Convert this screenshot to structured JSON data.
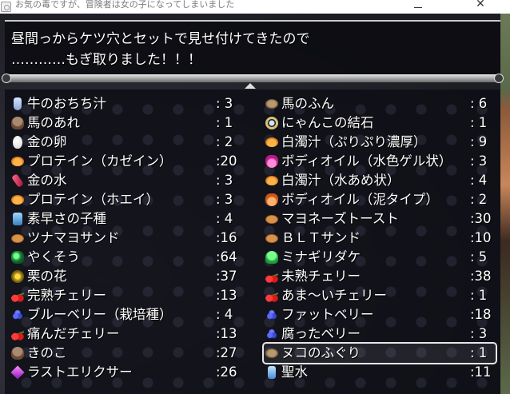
{
  "window": {
    "title": "お気の毒ですが、冒険者は女の子になってしまいました",
    "minimize_glyph": "—",
    "close_glyph": "✕"
  },
  "message": {
    "line1": "昼間っからケツ穴とセットで見せ付けてきたので",
    "line2": "…………もぎ取りました！！！"
  },
  "items_left": [
    {
      "icon": "bottle-icon",
      "name": "牛のおちち汁",
      "qty": ": 3"
    },
    {
      "icon": "mushroom-icon",
      "name": "馬のあれ",
      "qty": ": 1"
    },
    {
      "icon": "egg-icon",
      "name": "金の卵",
      "qty": ": 2"
    },
    {
      "icon": "shell-icon",
      "name": "プロテイン（カゼイン）",
      "qty": ":20"
    },
    {
      "icon": "red-vial-icon",
      "name": "金の水",
      "qty": ": 3"
    },
    {
      "icon": "shell-icon",
      "name": "プロテイン（ホエイ）",
      "qty": ": 3"
    },
    {
      "icon": "jar-icon",
      "name": "素早さの子種",
      "qty": ": 4"
    },
    {
      "icon": "bread-icon",
      "name": "ツナマヨサンド",
      "qty": ":16"
    },
    {
      "icon": "herb-icon",
      "name": "やくそう",
      "qty": ":64"
    },
    {
      "icon": "flower-icon",
      "name": "栗の花",
      "qty": ":37"
    },
    {
      "icon": "cherry-icon",
      "name": "完熟チェリー",
      "qty": ":13"
    },
    {
      "icon": "berry-icon",
      "name": "ブルーベリー（栽培種）",
      "qty": ": 4"
    },
    {
      "icon": "cherry-icon",
      "name": "痛んだチェリー",
      "qty": ":13"
    },
    {
      "icon": "mushroom-icon",
      "name": "きのこ",
      "qty": ":27"
    },
    {
      "icon": "gem-icon",
      "name": "ラストエリクサー",
      "qty": ":26"
    }
  ],
  "items_right": [
    {
      "icon": "dung-icon",
      "name": "馬のふん",
      "qty": ": 6"
    },
    {
      "icon": "ring-icon",
      "name": "にゃんこの結石",
      "qty": ": 1"
    },
    {
      "icon": "shell-icon",
      "name": "白濁汁（ぷりぷり濃厚）",
      "qty": ": 9"
    },
    {
      "icon": "potion-icon",
      "name": "ボディオイル（水色ゲル状）",
      "qty": ": 3"
    },
    {
      "icon": "shell-icon",
      "name": "白濁汁（水あめ状）",
      "qty": ": 4"
    },
    {
      "icon": "potion-orange-icon",
      "name": "ボディオイル（泥タイプ）",
      "qty": ": 2"
    },
    {
      "icon": "bread-icon",
      "name": "マヨネーズトースト",
      "qty": ":30"
    },
    {
      "icon": "bread-icon",
      "name": "ＢＬＴサンド",
      "qty": ":10"
    },
    {
      "icon": "mushroom-green-icon",
      "name": "ミナギリダケ",
      "qty": ": 5"
    },
    {
      "icon": "cherry-icon",
      "name": "未熟チェリー",
      "qty": ":38"
    },
    {
      "icon": "cherry-icon",
      "name": "あま～いチェリー",
      "qty": ": 1"
    },
    {
      "icon": "berry-icon",
      "name": "ファットベリー",
      "qty": ":18"
    },
    {
      "icon": "berry-icon",
      "name": "腐ったベリー",
      "qty": ": 3"
    },
    {
      "icon": "dung-icon",
      "name": "ヌコのふぐり",
      "qty": ": 1",
      "selected": true
    },
    {
      "icon": "water-icon",
      "name": "聖水",
      "qty": ":11"
    }
  ]
}
